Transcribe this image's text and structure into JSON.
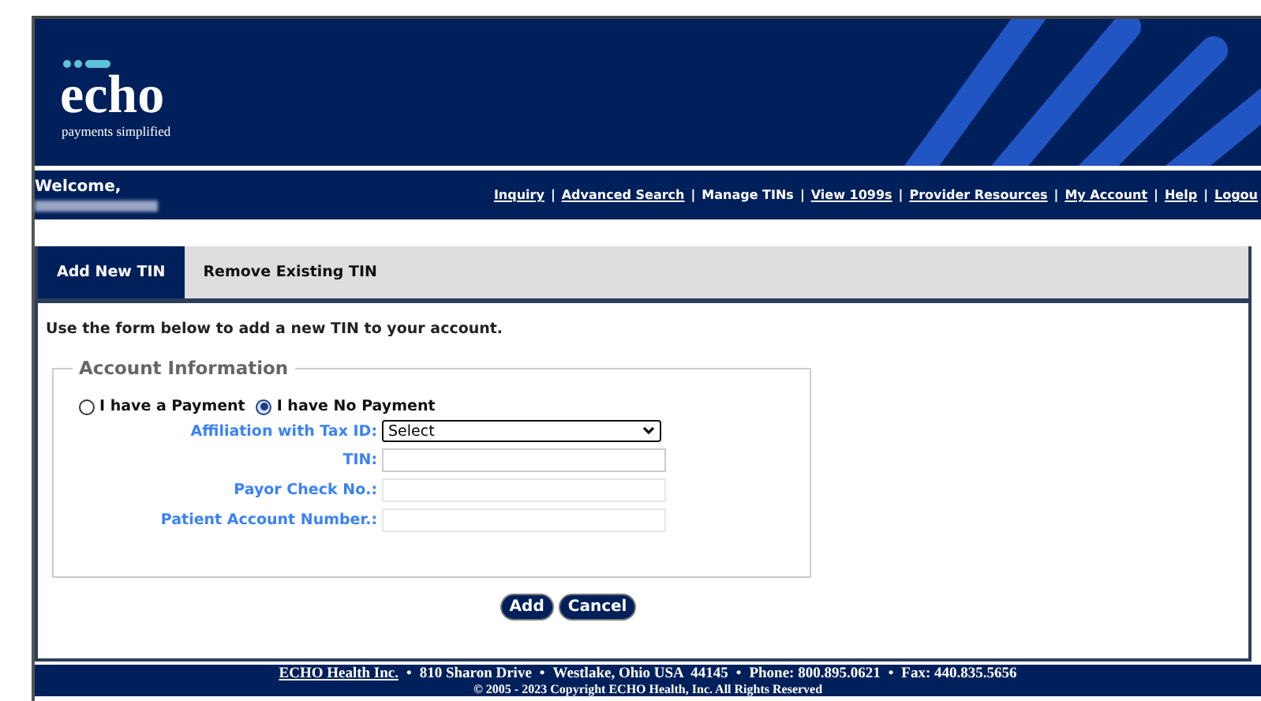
{
  "header": {
    "logo": "echo",
    "tagline": "payments simplified"
  },
  "welcome": {
    "label": "Welcome,"
  },
  "nav": [
    {
      "label": "Inquiry",
      "selected": false
    },
    {
      "separator": "|",
      "label": "Advanced Search",
      "selected": false
    },
    {
      "separator": "|",
      "label": "Manage TINs",
      "selected": true
    },
    {
      "separator": "|",
      "label": "View 1099s",
      "selected": false
    },
    {
      "separator": "|",
      "label": "Provider Resources",
      "selected": false
    },
    {
      "separator": "|",
      "label": "My Account",
      "selected": false
    },
    {
      "separator": "|",
      "label": "Help",
      "selected": false
    },
    {
      "separator": "|",
      "label": "Logou",
      "selected": false
    }
  ],
  "tabs": [
    {
      "label": "Add New TIN",
      "selected": true
    },
    {
      "label": "Remove Existing TIN",
      "selected": false
    }
  ],
  "intro": "Use the form below to add a new TIN to your account.",
  "fieldset": {
    "legend": "Account Information",
    "radios": [
      {
        "label": "I have a Payment",
        "selected": false
      },
      {
        "label": "I have No Payment",
        "selected": true
      }
    ],
    "fields": [
      {
        "kind": "select",
        "label": "Affiliation with Tax ID:",
        "value": "Select"
      },
      {
        "kind": "text",
        "label": "TIN:"
      },
      {
        "kind": "text",
        "label": "Payor Check No.:",
        "disabled": true
      },
      {
        "kind": "text",
        "label": "Patient Account Number.:",
        "disabled": true
      }
    ]
  },
  "buttons": [
    "Add",
    "Cancel"
  ],
  "footer": {
    "company": "ECHO Health Inc.",
    "parts": [
      {
        "bullet": "•",
        "text": "810 Sharon Drive"
      },
      {
        "bullet": "•",
        "text": "Westlake, Ohio USA  44145"
      },
      {
        "bullet": "•",
        "text": "Phone: 800.895.0621"
      },
      {
        "bullet": "•",
        "text": "Fax: 440.835.5656"
      }
    ],
    "copyright": "© 2005 - 2023 Copyright ECHO Health, Inc. All Rights Reserved"
  }
}
